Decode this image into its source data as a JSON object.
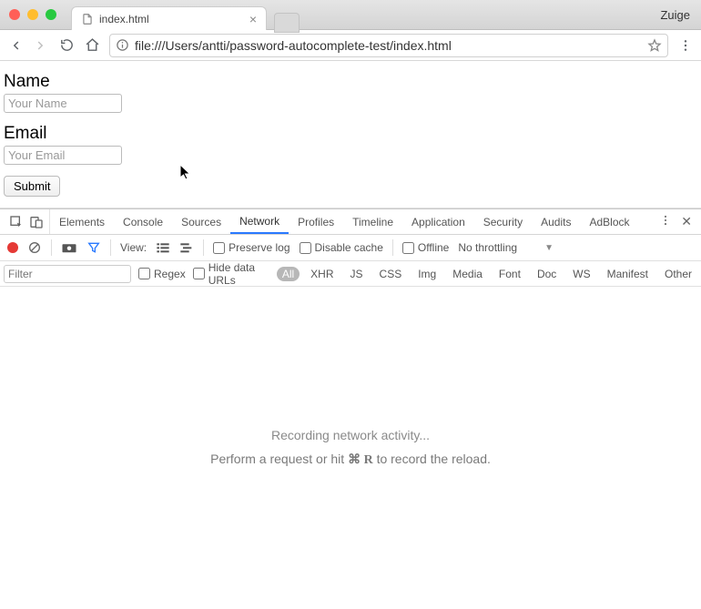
{
  "window": {
    "tab_label": "index.html",
    "profile_name": "Zuige"
  },
  "toolbar": {
    "url": "file:///Users/antti/password-autocomplete-test/index.html"
  },
  "page": {
    "name_label": "Name",
    "name_placeholder": "Your Name",
    "email_label": "Email",
    "email_placeholder": "Your Email",
    "submit_label": "Submit"
  },
  "devtools": {
    "tabs": [
      "Elements",
      "Console",
      "Sources",
      "Network",
      "Profiles",
      "Timeline",
      "Application",
      "Security",
      "Audits",
      "AdBlock"
    ],
    "active_tab": "Network",
    "row2": {
      "view_label": "View:",
      "preserve_log": "Preserve log",
      "disable_cache": "Disable cache",
      "offline": "Offline",
      "throttling": "No throttling"
    },
    "row3": {
      "filter_placeholder": "Filter",
      "regex": "Regex",
      "hide_data_urls": "Hide data URLs",
      "chips": [
        "All",
        "XHR",
        "JS",
        "CSS",
        "Img",
        "Media",
        "Font",
        "Doc",
        "WS",
        "Manifest",
        "Other"
      ],
      "active_chip": "All"
    },
    "body": {
      "line1": "Recording network activity...",
      "line2_prefix": "Perform a request or hit ",
      "line2_shortcut": "⌘ R",
      "line2_suffix": " to record the reload."
    }
  }
}
